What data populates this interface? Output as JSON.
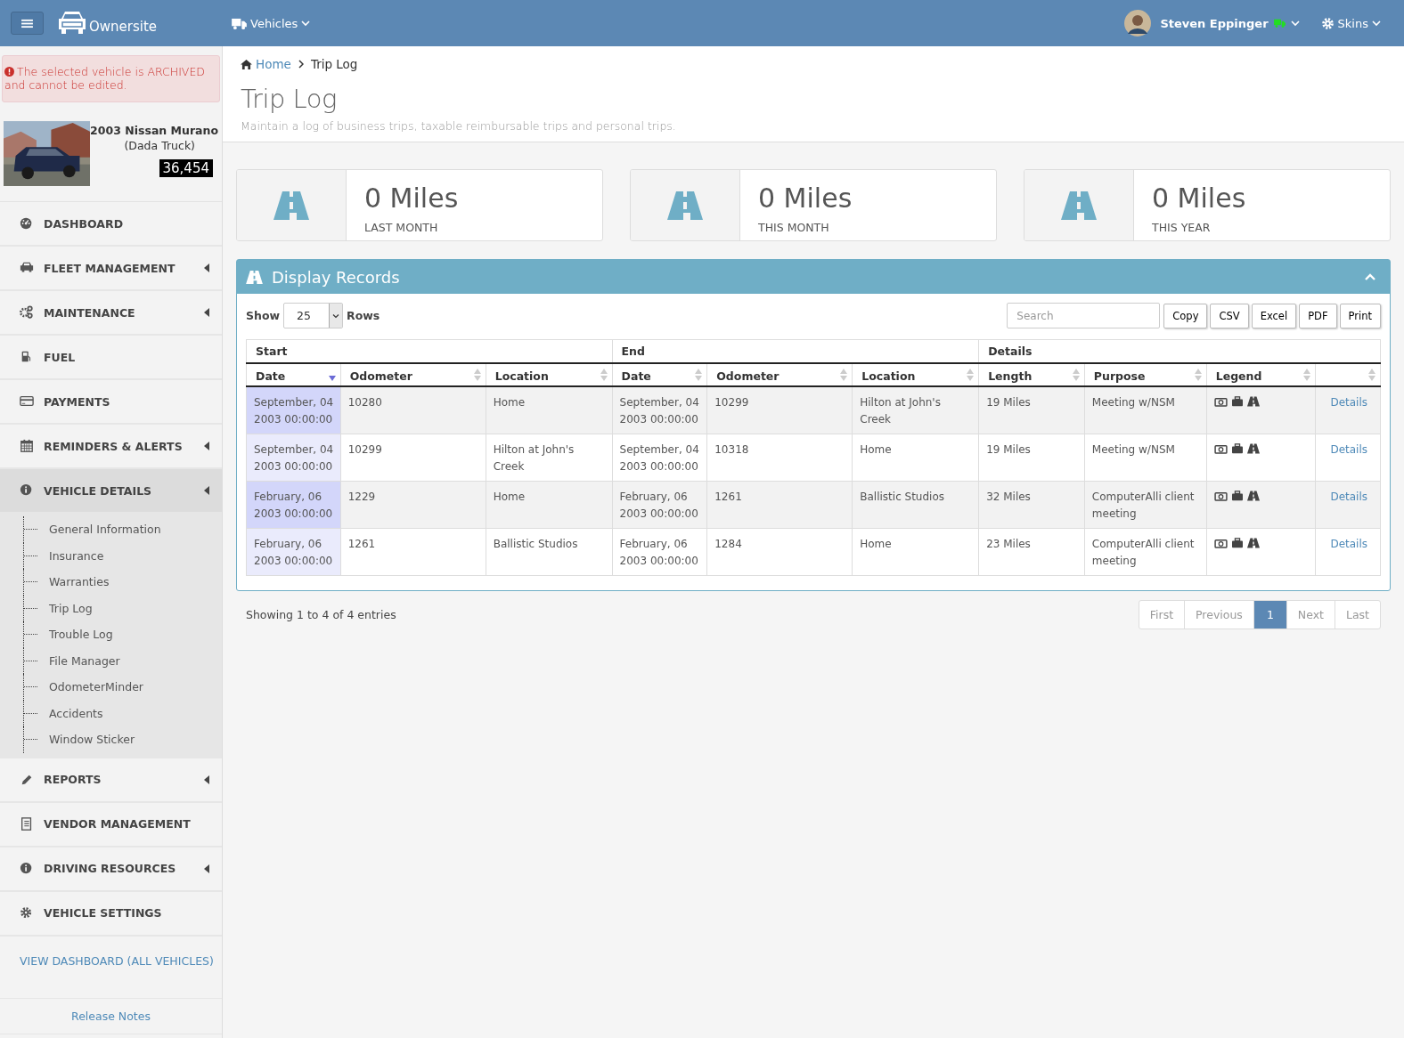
{
  "topbar": {
    "brand": "Ownersite",
    "vehicles_menu": "Vehicles",
    "user": "Steven Eppinger",
    "skins_menu": "Skins"
  },
  "sidebar": {
    "alert": "The selected vehicle is ARCHIVED and cannot be edited.",
    "vehicle": {
      "name": "2003 Nissan Murano",
      "nickname": "(Dada Truck)",
      "odometer": "36,454"
    },
    "items": [
      {
        "label": "DASHBOARD",
        "expandable": false,
        "expanded": false
      },
      {
        "label": "FLEET MANAGEMENT",
        "expandable": true,
        "expanded": false
      },
      {
        "label": "MAINTENANCE",
        "expandable": true,
        "expanded": false
      },
      {
        "label": "FUEL",
        "expandable": false,
        "expanded": false
      },
      {
        "label": "PAYMENTS",
        "expandable": false,
        "expanded": false
      },
      {
        "label": "REMINDERS & ALERTS",
        "expandable": true,
        "expanded": false
      },
      {
        "label": "VEHICLE DETAILS",
        "expandable": true,
        "expanded": true,
        "children": [
          {
            "label": "General Information"
          },
          {
            "label": "Insurance"
          },
          {
            "label": "Warranties"
          },
          {
            "label": "Trip Log"
          },
          {
            "label": "Trouble Log"
          },
          {
            "label": "File Manager"
          },
          {
            "label": "OdometerMinder"
          },
          {
            "label": "Accidents"
          },
          {
            "label": "Window Sticker"
          }
        ]
      },
      {
        "label": "REPORTS",
        "expandable": true,
        "expanded": false
      },
      {
        "label": "VENDOR MANAGEMENT",
        "expandable": false,
        "expanded": false
      },
      {
        "label": "DRIVING RESOURCES",
        "expandable": true,
        "expanded": false
      },
      {
        "label": "VEHICLE SETTINGS",
        "expandable": false,
        "expanded": false
      }
    ],
    "all_vehicles_link": "VIEW DASHBOARD (ALL VEHICLES)",
    "release_notes": "Release Notes"
  },
  "breadcrumb": [
    "Home",
    "Trip Log"
  ],
  "page": {
    "title": "Trip Log",
    "subtitle": "Maintain a log of business trips, taxable reimbursable trips and personal trips."
  },
  "stats": [
    {
      "value": "0 Miles",
      "label": "LAST MONTH"
    },
    {
      "value": "0 Miles",
      "label": "THIS MONTH"
    },
    {
      "value": "0 Miles",
      "label": "THIS YEAR"
    }
  ],
  "panel": {
    "title": "Display Records",
    "show_label": "Show",
    "rows_per_page": "25",
    "rows_label": "Rows",
    "search": {
      "placeholder": "Search"
    },
    "export_buttons": [
      "Copy",
      "CSV",
      "Excel",
      "PDF",
      "Print"
    ],
    "table": {
      "groups": [
        "Start",
        "End",
        "Details"
      ],
      "columns": [
        {
          "label": "Date",
          "sorted": true
        },
        {
          "label": "Odometer",
          "sorted": false
        },
        {
          "label": "Location",
          "sorted": false
        },
        {
          "label": "Date",
          "sorted": false
        },
        {
          "label": "Odometer",
          "sorted": false
        },
        {
          "label": "Location",
          "sorted": false
        },
        {
          "label": "Length",
          "sorted": false
        },
        {
          "label": "Purpose",
          "sorted": false
        },
        {
          "label": "Legend",
          "sorted": false
        },
        {
          "sorted": false
        }
      ],
      "rows": [
        {
          "cells": [
            "September, 04 2003 00:00:00",
            "10280",
            "Home",
            "September, 04 2003 00:00:00",
            "10299",
            "Hilton at John's Creek",
            "19 Miles",
            "Meeting w/NSM"
          ],
          "link": "Details"
        },
        {
          "cells": [
            "September, 04 2003 00:00:00",
            "10299",
            "Hilton at John's Creek",
            "September, 04 2003 00:00:00",
            "10318",
            "Home",
            "19 Miles",
            "Meeting w/NSM"
          ],
          "link": "Details"
        },
        {
          "cells": [
            "February, 06 2003 00:00:00",
            "1229",
            "Home",
            "February, 06 2003 00:00:00",
            "1261",
            "Ballistic Studios",
            "32 Miles",
            "ComputerAlli client meeting"
          ],
          "link": "Details"
        },
        {
          "cells": [
            "February, 06 2003 00:00:00",
            "1261",
            "Ballistic Studios",
            "February, 06 2003 00:00:00",
            "1284",
            "Home",
            "23 Miles",
            "ComputerAlli client meeting"
          ],
          "link": "Details"
        }
      ]
    }
  },
  "info": "Showing 1 to 4 of 4 entries",
  "pagination": [
    {
      "label": "First",
      "selected": false,
      "disabled": true
    },
    {
      "label": "Previous",
      "selected": false,
      "disabled": true
    },
    {
      "label": "1",
      "selected": true,
      "disabled": false
    },
    {
      "label": "Next",
      "selected": false,
      "disabled": true
    },
    {
      "label": "Last",
      "selected": false,
      "disabled": true
    }
  ]
}
